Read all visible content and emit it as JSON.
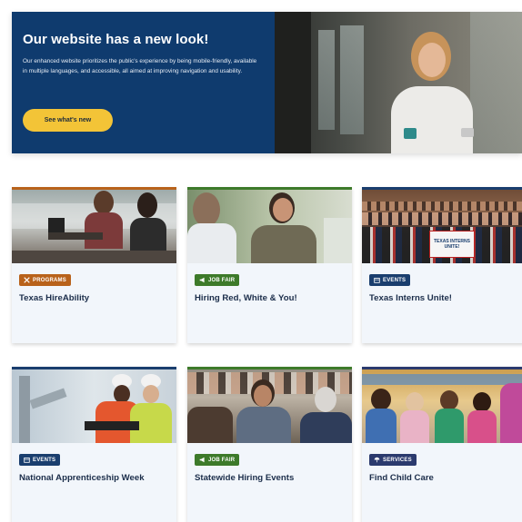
{
  "hero": {
    "title": "Our website has a new look!",
    "body": "Our enhanced website prioritizes the public's experience by being mobile-friendly, available in multiple languages, and accessible, all aimed at improving navigation and usability.",
    "button_label": "See what's new",
    "accent": "#0f3b6e",
    "button_color": "#f3c437"
  },
  "cards": [
    {
      "category": "PROGRAMS",
      "icon": "tools-icon",
      "title": "Texas HireAbility",
      "color": "#b8621b"
    },
    {
      "category": "JOB FAIR",
      "icon": "megaphone-icon",
      "title": "Hiring Red, White & You!",
      "color": "#3d7a2a"
    },
    {
      "category": "EVENTS",
      "icon": "calendar-icon",
      "title": "Texas Interns Unite!",
      "color": "#1a3e6e",
      "photo_sign": "TEXAS INTERNS UNITE!"
    },
    {
      "category": "EVENTS",
      "icon": "calendar-icon",
      "title": "National Apprenticeship Week",
      "color": "#1a3e6e"
    },
    {
      "category": "JOB FAIR",
      "icon": "megaphone-icon",
      "title": "Statewide Hiring Events",
      "color": "#3d7a2a"
    },
    {
      "category": "SERVICES",
      "icon": "umbrella-icon",
      "title": "Find Child Care",
      "color": "#2b3a6e"
    }
  ]
}
